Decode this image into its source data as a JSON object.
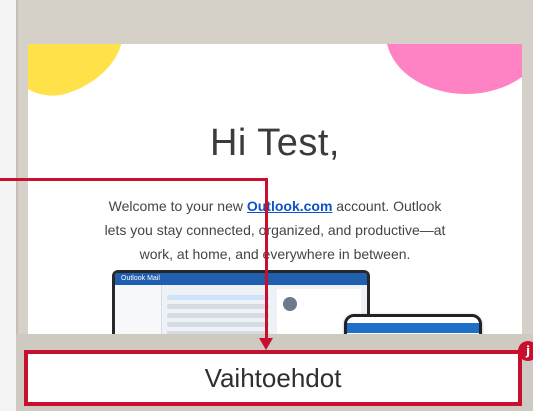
{
  "email": {
    "greeting": "Hi Test,",
    "welcome_prefix": "Welcome to your new ",
    "welcome_link": "Outlook.com",
    "welcome_suffix": " account. Outlook lets you stay connected, organized, and productive—at work, at home, and everywhere in between.",
    "preview_app_title": "Outlook  Mail"
  },
  "option": {
    "label": "Vaihtoehdot",
    "marker": "j"
  },
  "colors": {
    "callout": "#c8102e",
    "link": "#0f52c7",
    "blob_yellow": "#ffe14a",
    "blob_pink": "#ff83c4",
    "frame": "#d6d1c8"
  }
}
